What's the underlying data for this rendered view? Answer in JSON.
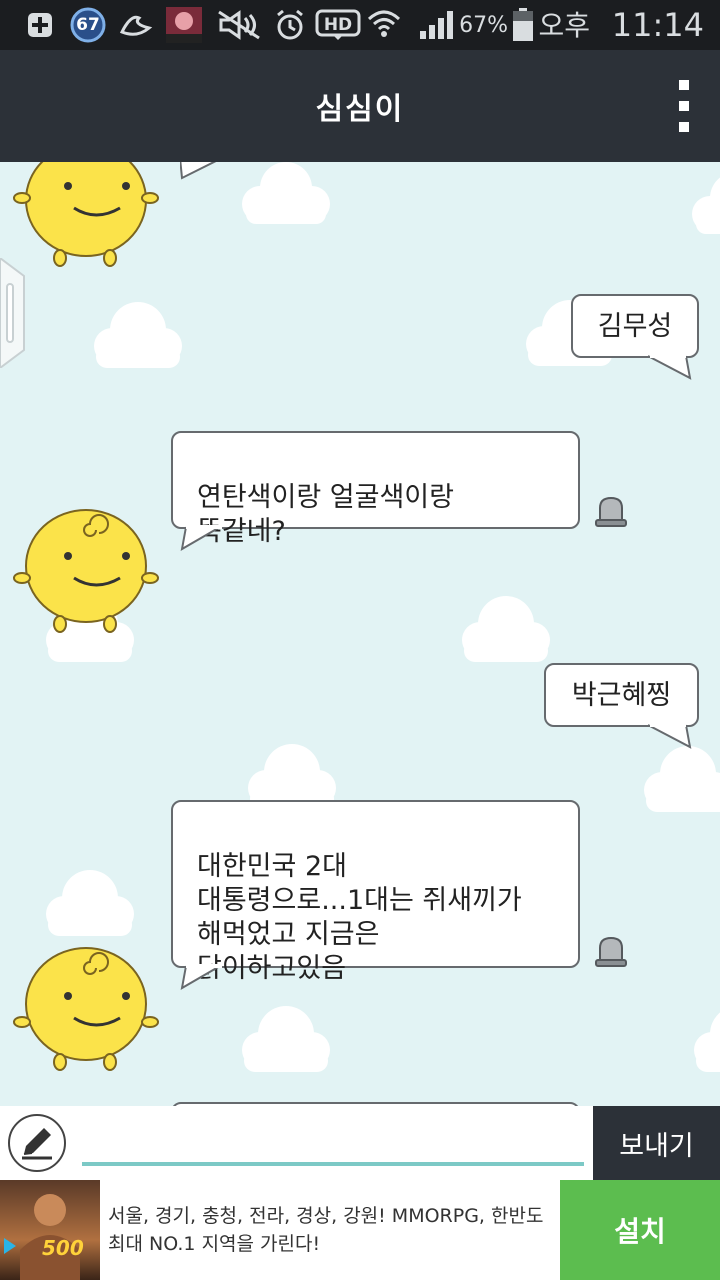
{
  "status_bar": {
    "notification_badge": "67",
    "battery_percent": "67%",
    "ampm": "오후",
    "time": "11:14"
  },
  "app_bar": {
    "title": "심심이"
  },
  "messages": [
    {
      "sender": "user",
      "text": "김무성"
    },
    {
      "sender": "simsimi",
      "text": "연탄색이랑 얼굴색이랑\n똑같네?"
    },
    {
      "sender": "user",
      "text": "박근혜찡"
    },
    {
      "sender": "simsimi",
      "text": "대한민국 2대\n대통령으로...1대는 쥐새끼가\n해먹었고 지금은\n닭이하고있음"
    }
  ],
  "input": {
    "value": "",
    "placeholder": "",
    "send_label": "보내기"
  },
  "ad": {
    "image_text": "500",
    "text": "서울, 경기, 충청, 전라, 경상, 강원! MMORPG, 한반도 최대 NO.1 지역을 가린다!",
    "install_label": "설치"
  },
  "colors": {
    "status_bar": "#1b1d20",
    "app_bar": "#2c3138",
    "chat_background": "#e2f3f4",
    "input_underline": "#7cc9c6",
    "install_button": "#5cbd4f",
    "simsimi_body": "#fbe34a"
  }
}
